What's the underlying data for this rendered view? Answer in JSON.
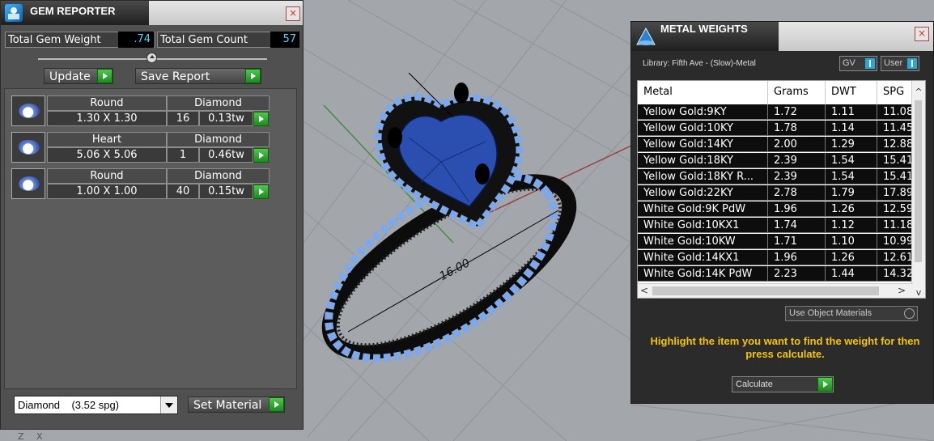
{
  "gem_reporter": {
    "title": "GEM REPORTER",
    "close": "×",
    "total_weight_label": "Total Gem Weight",
    "total_weight_value": ".74",
    "total_count_label": "Total Gem Count",
    "total_count_value": "57",
    "update_label": "Update",
    "save_report_label": "Save Report",
    "gems": [
      {
        "shape": "Round",
        "type": "Diamond",
        "size": "1.30 X 1.30",
        "count": "16",
        "weight": "0.13tw"
      },
      {
        "shape": "Heart",
        "type": "Diamond",
        "size": "5.06 X 5.06",
        "count": "1",
        "weight": "0.46tw"
      },
      {
        "shape": "Round",
        "type": "Diamond",
        "size": "1.00 X 1.00",
        "count": "40",
        "weight": "0.15tw"
      }
    ],
    "material_select": "Diamond    (3.52 spg)",
    "set_material_label": "Set Material"
  },
  "metal_weights": {
    "title": "METAL WEIGHTS",
    "close": "×",
    "library_label": "Library: Fifth Ave - (Slow)-Metal",
    "toggle_gv": "GV",
    "toggle_user": "User",
    "columns": [
      "Metal",
      "Grams",
      "DWT",
      "SPG"
    ],
    "rows": [
      [
        "Yellow Gold:9KY",
        "1.72",
        "1.11",
        "11.08"
      ],
      [
        "Yellow Gold:10KY",
        "1.78",
        "1.14",
        "11.45"
      ],
      [
        "Yellow Gold:14KY",
        "2.00",
        "1.29",
        "12.88"
      ],
      [
        "Yellow Gold:18KY",
        "2.39",
        "1.54",
        "15.41"
      ],
      [
        "Yellow Gold:18KY R...",
        "2.39",
        "1.54",
        "15.41"
      ],
      [
        "Yellow Gold:22KY",
        "2.78",
        "1.79",
        "17.89"
      ],
      [
        "White Gold:9K PdW",
        "1.96",
        "1.26",
        "12.59"
      ],
      [
        "White Gold:10KX1",
        "1.74",
        "1.12",
        "11.18"
      ],
      [
        "White Gold:10KW",
        "1.71",
        "1.10",
        "10.99"
      ],
      [
        "White Gold:14KX1",
        "1.96",
        "1.26",
        "12.61"
      ],
      [
        "White Gold:14K PdW",
        "2.23",
        "1.44",
        "14.32"
      ]
    ],
    "use_object_materials": "Use Object Materials",
    "hint": "Highlight the item you want to find the weight for then press calculate.",
    "calculate_label": "Calculate"
  },
  "viewport": {
    "dimension_label": "16.00",
    "axis_hint": "Z  X"
  }
}
